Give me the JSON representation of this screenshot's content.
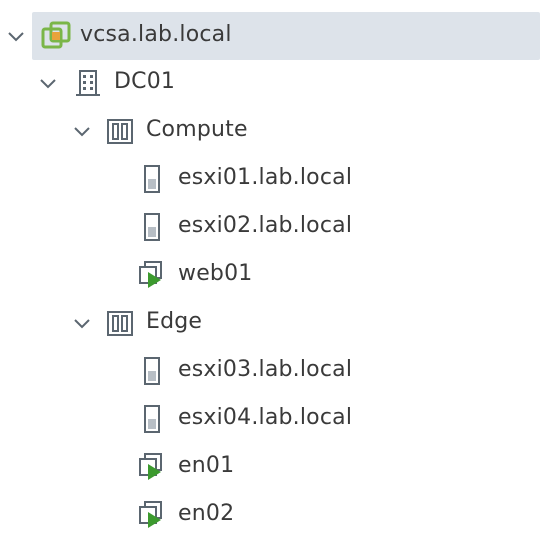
{
  "tree": {
    "vcenter": {
      "label": "vcsa.lab.local",
      "icon": "vcenter-icon",
      "expanded": true,
      "selected": true
    },
    "datacenter": {
      "label": "DC01",
      "icon": "datacenter-icon",
      "expanded": true
    },
    "clusters": [
      {
        "label": "Compute",
        "icon": "cluster-icon",
        "expanded": true,
        "children": [
          {
            "label": "esxi01.lab.local",
            "icon": "host-icon"
          },
          {
            "label": "esxi02.lab.local",
            "icon": "host-icon"
          },
          {
            "label": "web01",
            "icon": "vm-running-icon"
          }
        ]
      },
      {
        "label": "Edge",
        "icon": "cluster-icon",
        "expanded": true,
        "children": [
          {
            "label": "esxi03.lab.local",
            "icon": "host-icon"
          },
          {
            "label": "esxi04.lab.local",
            "icon": "host-icon"
          },
          {
            "label": "en01",
            "icon": "vm-running-icon"
          },
          {
            "label": "en02",
            "icon": "vm-running-icon"
          }
        ]
      }
    ]
  },
  "colors": {
    "selected_bg": "#dde3ea",
    "text": "#3a3a3a",
    "icon_gray": "#5b6670",
    "vcenter_green": "#7ab648",
    "vcenter_orange": "#e8a33b",
    "vm_play_green": "#3c9a2e"
  }
}
